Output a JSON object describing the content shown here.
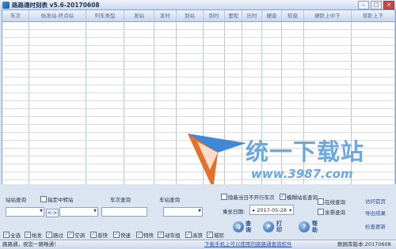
{
  "window": {
    "title": "路路通时刻表 v5.6-20170608",
    "minimize": "–",
    "maximize": "□",
    "close": "×"
  },
  "columns": [
    "车次",
    "始发站-终点站",
    "列车类型",
    "发站",
    "发时",
    "到站",
    "到时",
    "里程",
    "历时",
    "硬座",
    "软座",
    "硬卧上中下",
    "软卧上下"
  ],
  "watermark": {
    "brand": "统一下载站",
    "url": "www.3987.com"
  },
  "query": {
    "station_label": "站站查询",
    "transfer_label": "指定中转站",
    "swap_label": "<->",
    "train_label": "车次查询",
    "stop_label": "车站查询",
    "hide_label": "隐蔽当日不开行车次",
    "fuzzy_label": "模糊站名查询",
    "date_label": "乘坐日期:",
    "date_value": "2017-05-28",
    "online_label": "在线查询",
    "remaining_label": "余票查询"
  },
  "buttons": {
    "query": "查询",
    "print": "打印",
    "help": "帮助"
  },
  "links": {
    "home": "访问首页",
    "export": "导出结果",
    "update": "检查更新"
  },
  "filters": [
    "全选",
    "始发",
    "路过",
    "空调",
    "普快",
    "快速",
    "特快",
    "动车组",
    "高铁",
    "城际"
  ],
  "status": {
    "left": "路路通，祝您一路畅通！",
    "middle": "下载手机上可以使用的路路通查询软件",
    "right": "数据库版本:20170608"
  }
}
